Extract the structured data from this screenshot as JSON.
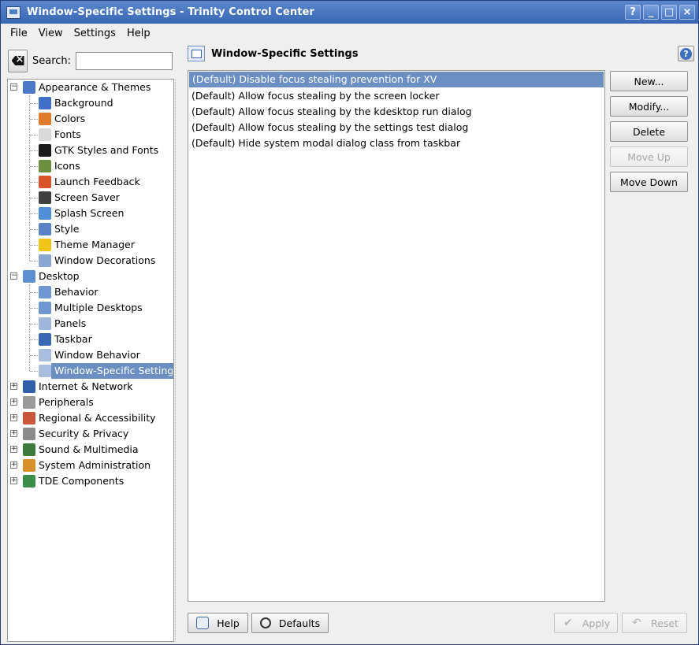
{
  "window": {
    "title": "Window-Specific Settings - Trinity Control Center",
    "buttons": {
      "help": "?",
      "minimize": "_",
      "maximize": "□",
      "close": "×"
    }
  },
  "menu": [
    "File",
    "View",
    "Settings",
    "Help"
  ],
  "search": {
    "label": "Search:",
    "value": "",
    "placeholder": ""
  },
  "tree": [
    {
      "label": "Appearance & Themes",
      "icon": "appearance-icon",
      "expanded": true,
      "color": "#4c78c8",
      "children": [
        {
          "label": "Background",
          "icon": "background-icon",
          "color": "#3f6fc6"
        },
        {
          "label": "Colors",
          "icon": "colors-icon",
          "color": "#e07b2e"
        },
        {
          "label": "Fonts",
          "icon": "fonts-icon",
          "color": "#d9d9d9"
        },
        {
          "label": "GTK Styles and Fonts",
          "icon": "gtk-icon",
          "color": "#1c1c1c"
        },
        {
          "label": "Icons",
          "icon": "icons-icon",
          "color": "#6b8f3c"
        },
        {
          "label": "Launch Feedback",
          "icon": "launch-feedback-icon",
          "color": "#d9532a"
        },
        {
          "label": "Screen Saver",
          "icon": "screen-saver-icon",
          "color": "#404040"
        },
        {
          "label": "Splash Screen",
          "icon": "splash-screen-icon",
          "color": "#4f8fd6"
        },
        {
          "label": "Style",
          "icon": "style-icon",
          "color": "#5a83c7"
        },
        {
          "label": "Theme Manager",
          "icon": "theme-manager-icon",
          "color": "#f0c419"
        },
        {
          "label": "Window Decorations",
          "icon": "window-decorations-icon",
          "color": "#8aa6d3"
        }
      ]
    },
    {
      "label": "Desktop",
      "icon": "desktop-icon",
      "expanded": true,
      "color": "#5e8fd2",
      "children": [
        {
          "label": "Behavior",
          "icon": "behavior-icon",
          "color": "#6f97d4"
        },
        {
          "label": "Multiple Desktops",
          "icon": "multiple-desktops-icon",
          "color": "#6f97d4"
        },
        {
          "label": "Panels",
          "icon": "panels-icon",
          "color": "#9fb6dc"
        },
        {
          "label": "Taskbar",
          "icon": "taskbar-icon",
          "color": "#3a68b5"
        },
        {
          "label": "Window Behavior",
          "icon": "window-behavior-icon",
          "color": "#a9bedf"
        },
        {
          "label": "Window-Specific Settings",
          "icon": "window-specific-icon",
          "color": "#a9bedf",
          "selected": true
        }
      ]
    },
    {
      "label": "Internet & Network",
      "icon": "internet-icon",
      "expanded": false,
      "color": "#2f5fa8",
      "children": []
    },
    {
      "label": "Peripherals",
      "icon": "peripherals-icon",
      "expanded": false,
      "color": "#9a9a9a",
      "children": []
    },
    {
      "label": "Regional & Accessibility",
      "icon": "regional-icon",
      "expanded": false,
      "color": "#c9553a",
      "children": []
    },
    {
      "label": "Security & Privacy",
      "icon": "security-icon",
      "expanded": false,
      "color": "#8c8c8c",
      "children": []
    },
    {
      "label": "Sound & Multimedia",
      "icon": "sound-icon",
      "expanded": false,
      "color": "#3d7a3d",
      "children": []
    },
    {
      "label": "System Administration",
      "icon": "system-admin-icon",
      "expanded": false,
      "color": "#d9902a",
      "children": []
    },
    {
      "label": "TDE Components",
      "icon": "tde-components-icon",
      "expanded": false,
      "color": "#3c8c4a",
      "children": []
    }
  ],
  "panel": {
    "title": "Window-Specific Settings",
    "rules": [
      "(Default) Disable focus stealing prevention for XV",
      "(Default) Allow focus stealing by the screen locker",
      "(Default) Allow focus stealing by the kdesktop run dialog",
      "(Default) Allow focus stealing by the settings test dialog",
      "(Default) Hide system modal dialog class from taskbar"
    ],
    "selected_rule": 0,
    "side_buttons": [
      {
        "label": "New...",
        "name": "new-rule-button",
        "enabled": true
      },
      {
        "label": "Modify...",
        "name": "modify-rule-button",
        "enabled": true
      },
      {
        "label": "Delete",
        "name": "delete-rule-button",
        "enabled": true
      },
      {
        "label": "Move Up",
        "name": "move-up-button",
        "enabled": false
      },
      {
        "label": "Move Down",
        "name": "move-down-button",
        "enabled": true
      }
    ]
  },
  "bottom": {
    "help": "Help",
    "defaults": "Defaults",
    "apply": "Apply",
    "reset": "Reset"
  },
  "colors": {
    "selection": "#6c8fc3",
    "titlebar": "#3867b4"
  }
}
